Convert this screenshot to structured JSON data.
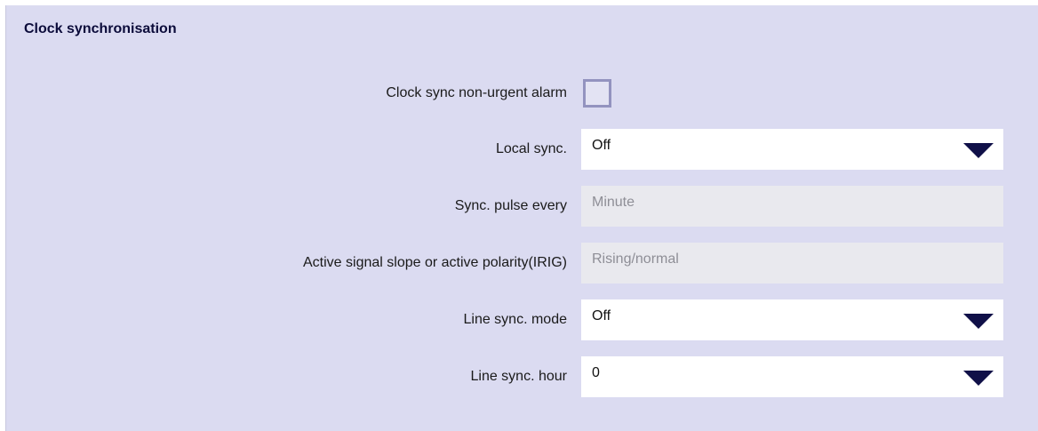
{
  "section": {
    "title": "Clock synchronisation"
  },
  "fields": {
    "non_urgent_alarm": {
      "label": "Clock sync non-urgent alarm",
      "checked": false
    },
    "local_sync": {
      "label": "Local sync.",
      "value": "Off",
      "icon": "chevron-down-icon"
    },
    "sync_pulse": {
      "label": "Sync. pulse every",
      "value": "Minute"
    },
    "signal_slope": {
      "label": "Active signal slope or active polarity(IRIG)",
      "value": "Rising/normal"
    },
    "line_sync_mode": {
      "label": "Line sync. mode",
      "value": "Off",
      "icon": "chevron-down-icon"
    },
    "line_sync_hour": {
      "label": "Line sync. hour",
      "value": "0",
      "icon": "chevron-down-icon"
    }
  },
  "colors": {
    "panel_background": "#dbdbf1",
    "caret": "#101048",
    "readonly_background": "#e9e9ee",
    "checkbox_border": "#9393bf"
  }
}
